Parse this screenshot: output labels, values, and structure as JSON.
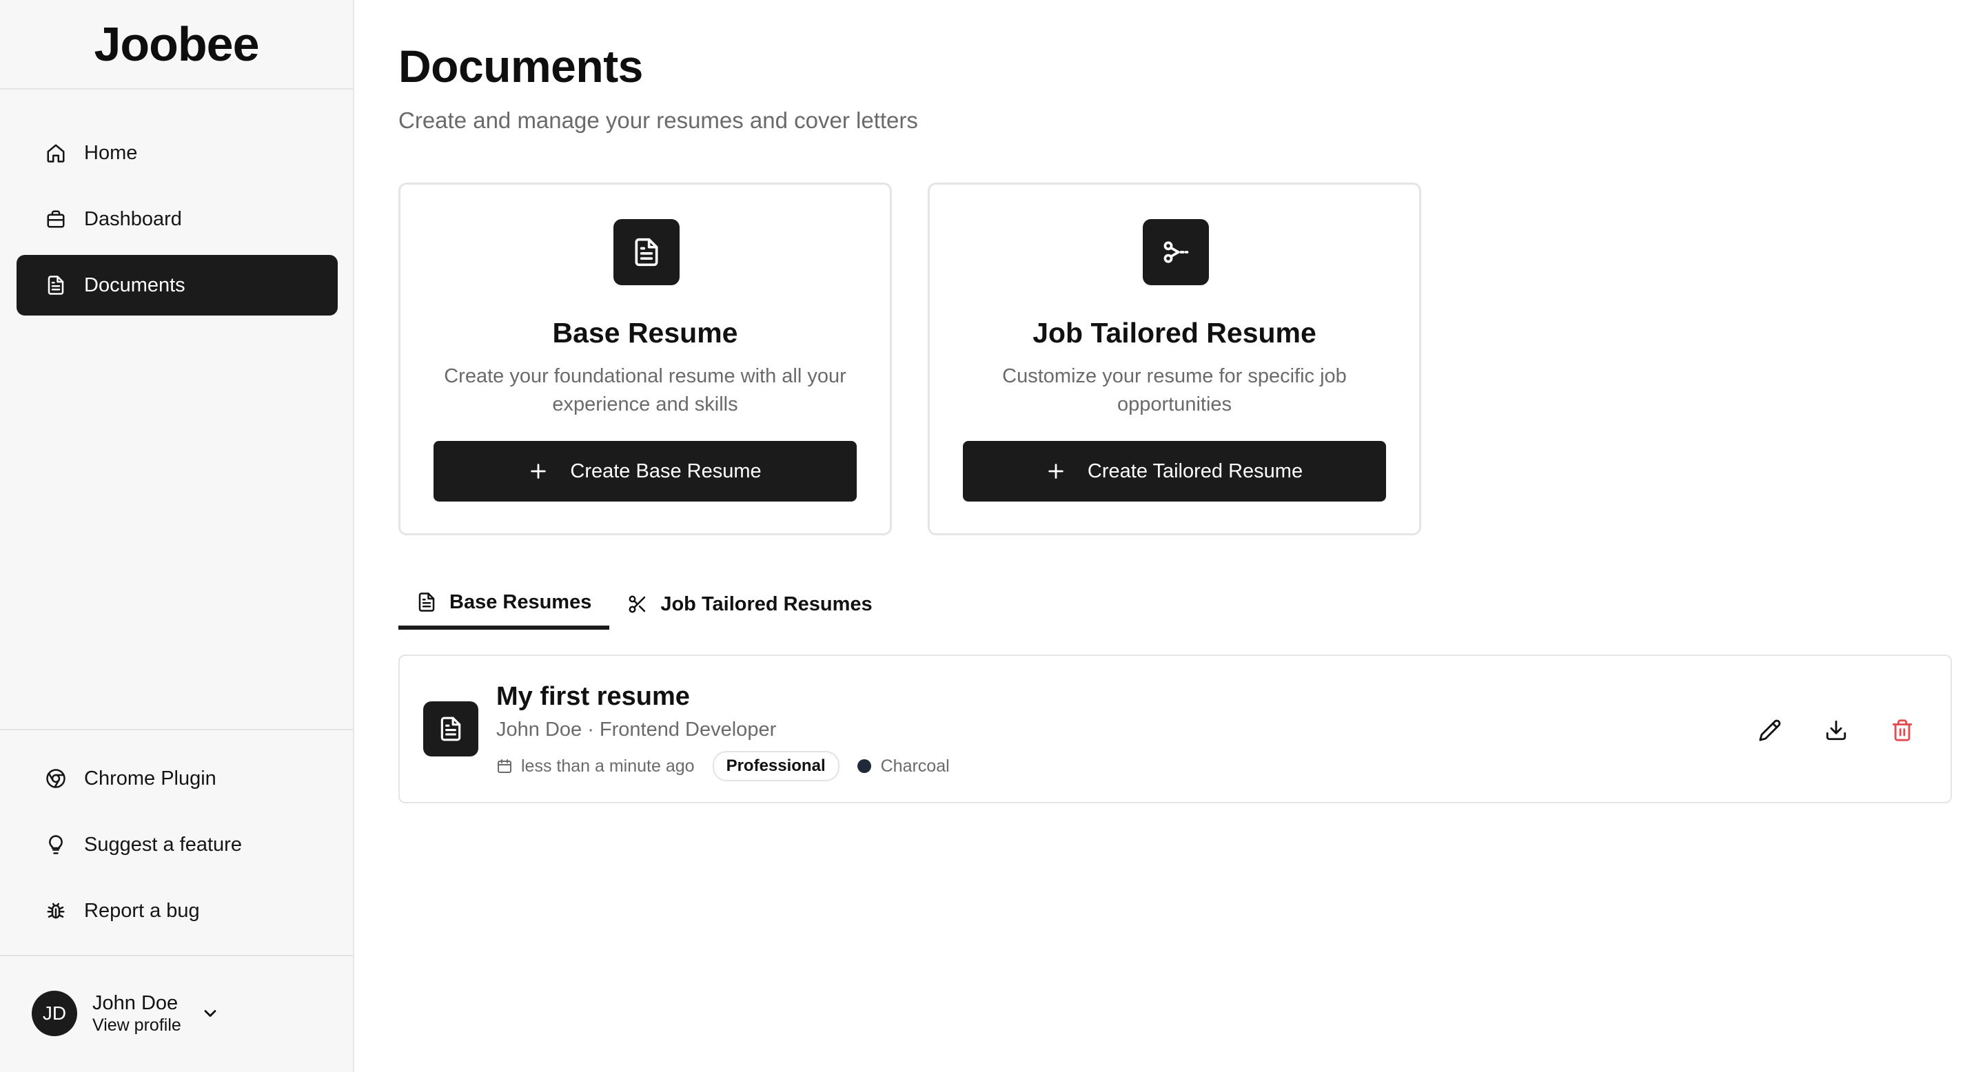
{
  "sidebar": {
    "logo": "Joobee",
    "nav": [
      {
        "label": "Home",
        "icon": "home-icon",
        "active": false
      },
      {
        "label": "Dashboard",
        "icon": "briefcase-icon",
        "active": false
      },
      {
        "label": "Documents",
        "icon": "document-icon",
        "active": true
      }
    ],
    "bottom_nav": [
      {
        "label": "Chrome Plugin",
        "icon": "chrome-icon"
      },
      {
        "label": "Suggest a feature",
        "icon": "lightbulb-icon"
      },
      {
        "label": "Report a bug",
        "icon": "bug-icon"
      }
    ],
    "profile": {
      "initials": "JD",
      "name": "John Doe",
      "link": "View profile"
    }
  },
  "main": {
    "title": "Documents",
    "subtitle": "Create and manage your resumes and cover letters",
    "cards": [
      {
        "title": "Base Resume",
        "description": "Create your foundational resume with all your experience and skills",
        "button": "Create Base Resume",
        "icon": "document-icon"
      },
      {
        "title": "Job Tailored Resume",
        "description": "Customize your resume for specific job opportunities",
        "button": "Create Tailored Resume",
        "icon": "scissors-icon"
      }
    ],
    "tabs": [
      {
        "label": "Base Resumes",
        "icon": "document-icon",
        "active": true
      },
      {
        "label": "Job Tailored Resumes",
        "icon": "scissors-icon",
        "active": false
      }
    ],
    "resumes": [
      {
        "title": "My first resume",
        "subtitle": "John Doe · Frontend Developer",
        "updated": "less than a minute ago",
        "template": "Professional",
        "color_name": "Charcoal",
        "color": "#1f2937"
      }
    ]
  },
  "colors": {
    "accent": "#1b1b1b",
    "danger": "#e5484d"
  }
}
